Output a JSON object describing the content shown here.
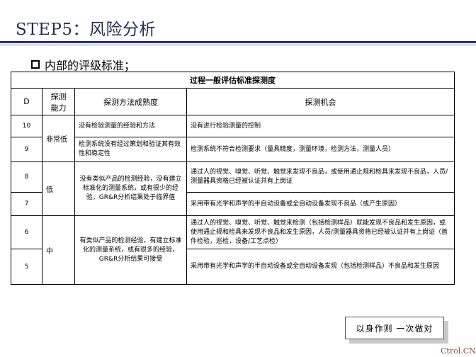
{
  "page": {
    "title": "STEP5：风险分析",
    "subheading": "内部的评级标准；",
    "watermark": "Ctrol.CN"
  },
  "table": {
    "caption": "过程一般评估标准探测度",
    "headers": {
      "d": "D",
      "ability": "探测能力",
      "method": "探测方法成熟度",
      "chance": "探测机会"
    },
    "rows": {
      "r10": {
        "d": "10",
        "method": "没有检验测量的经验和方法",
        "chance": "没有进行检验测量的控制"
      },
      "r9": {
        "d": "9",
        "method": "检测系统没有经过策划和验证其有效性和稳定性",
        "chance": "检测系统不符合检测要求（量具精度，测量环境，检测方法，测量人员）"
      },
      "r8": {
        "d": "8",
        "chance": "通过人的视觉、嗅觉、听觉、触觉来发现不良品，或使用通止规和检具来发现不良品，人员/测量器具资格已经被认证并有上岗证"
      },
      "r7": {
        "d": "7",
        "chance": "采用带有光学和声学的半自动设备或全自动设备发现不良品（或产生原因）"
      },
      "r6": {
        "d": "6",
        "chance": "通过人的视觉、嗅觉、听觉、触觉来检测（包括检测样品）就能发现不良品和发生原因，或使用通止规和检具来发现不良品和发生原因，人员/测量器具资格已经被认证并有上岗证（首件检验，巡检，设备/工艺点检）"
      },
      "r5": {
        "d": "5",
        "chance": "采用带有光学和声学的半自动设备或全自动设备发现（包括检测样品）不良品和发生原因"
      }
    },
    "groups": {
      "very_low": {
        "ability": "非常低"
      },
      "low": {
        "ability": "低",
        "method": "没有类似产品的检测经验，没有建立标准化的测量系统，或有很少的经验，GR&R分析结果处于临界值"
      },
      "medium": {
        "ability": "中",
        "method": "有类似产品的检测经验，有建立标准化的测量系统，或有很多的经验，GR&R分析结果可接受"
      }
    }
  },
  "footer": {
    "slogan": "以身作则  一次做对"
  }
}
